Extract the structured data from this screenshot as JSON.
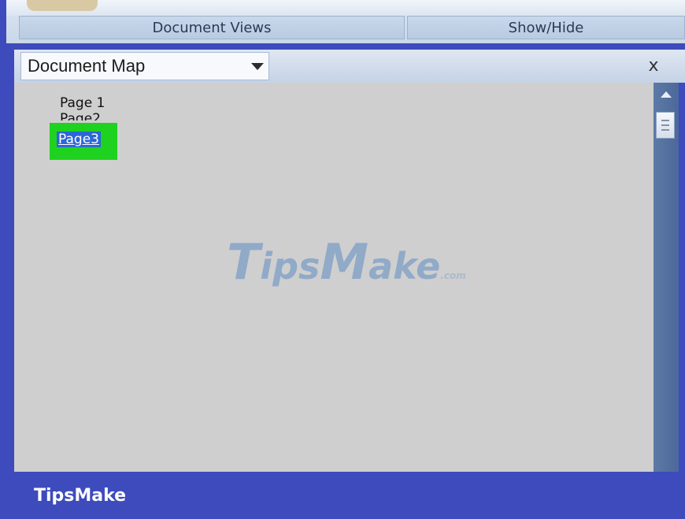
{
  "ribbon": {
    "groups": [
      {
        "label": "Document Views"
      },
      {
        "label": "Show/Hide"
      }
    ]
  },
  "pane": {
    "selector_value": "Document Map",
    "close_label": "x",
    "items": [
      {
        "label": "Page 1"
      },
      {
        "label": "Page2"
      },
      {
        "label": "Page3",
        "selected": true
      }
    ]
  },
  "watermark": {
    "big_1": "T",
    "mid_1": "ips",
    "big_2": "M",
    "mid_2": "ake",
    "suffix": ".com"
  },
  "footer": {
    "brand": "TipsMake"
  },
  "colors": {
    "frame": "#3d4bbd",
    "pane_background": "#cfcfcf",
    "highlight": "#1fd21f",
    "selection": "#2b67d6"
  },
  "icons": {
    "dropdown": "chevron-down-icon",
    "close": "close-icon",
    "scroll_up": "arrow-up-icon",
    "scroll_thumb": "grip-icon"
  }
}
